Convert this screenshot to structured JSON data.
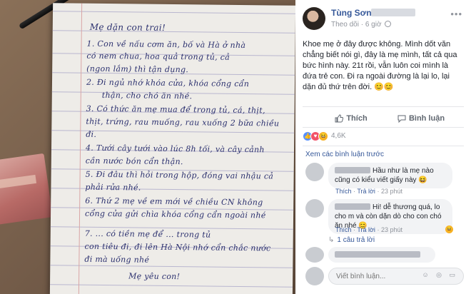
{
  "letter": {
    "lines": [
      "Mẹ dặn con trai!",
      "1. Con về nấu cơm ăn, bố và Hà ở nhà",
      "có nem chua, hoa quả trong tủ, cả",
      "(ngon lắm) thì tận dụng.",
      "2. Đi ngủ nhớ khóa cửa, khóa cổng cẩn",
      "thận, cho chó ăn nhé.",
      "3. Có thức ăn mẹ mua để trong tủ, cá, thịt,",
      "thịt, trứng, rau muống, rau xuống 2 bữa chiều",
      "đi.",
      "4. Tưới cây tưới vào lúc 8h tối, và cây cảnh",
      "cần nước bón cẩn thận.",
      "5. Đi đâu thì hỏi trong hộp, đóng vai nhậu cả",
      "phải rửa nhé.",
      "6. Thứ 2 mẹ về em mới về chiều CN không",
      "cổng cửa gửi chìa khóa cổng cẩn ngoài nhé",
      "7. ... có tiền mẹ để ... trong tủ",
      "con tiêu đi, đi lên Hà Nội nhớ cẩn chắc nước",
      "đi mà uống nhé",
      "Mẹ yêu con!"
    ]
  },
  "post": {
    "author": "Tùng Sơn",
    "follow_label": "Theo dõi",
    "separator": "·",
    "time": "6 giờ",
    "more_icon": "more-icon",
    "text": "Khoe mẹ ở đây được không. Mình dốt văn chẳng biết nói gì, đây là mẹ mình, tất cả qua bức hình này. 21t rồi, vẫn luôn coi mình là đứa trẻ con. Đi ra ngoài đường là lại lo, lại dặn đủ thứ trên đời. 😊😊",
    "like_label": "Thích",
    "comment_label": "Bình luận",
    "reaction_count": "4,6K",
    "view_prev_comments": "Xem các bình luận trước"
  },
  "comments": [
    {
      "text": "Hầu như là mẹ nào cũng có kiểu viết giấy này 😆",
      "like": "Thích",
      "reply": "Trả lời",
      "time": "23 phút"
    },
    {
      "text": "Hi! dễ thương quá, lo cho m và còn dặn dò cho con chó ăn nhé 😊",
      "like": "Thích",
      "reply": "Trả lời",
      "time": "23 phút"
    }
  ],
  "replies_label": "1 câu trả lời",
  "write_placeholder": "Viết bình luận...",
  "colors": {
    "link": "#365899",
    "like": "#5890ff",
    "love": "#f25268",
    "haha": "#f7b125"
  }
}
